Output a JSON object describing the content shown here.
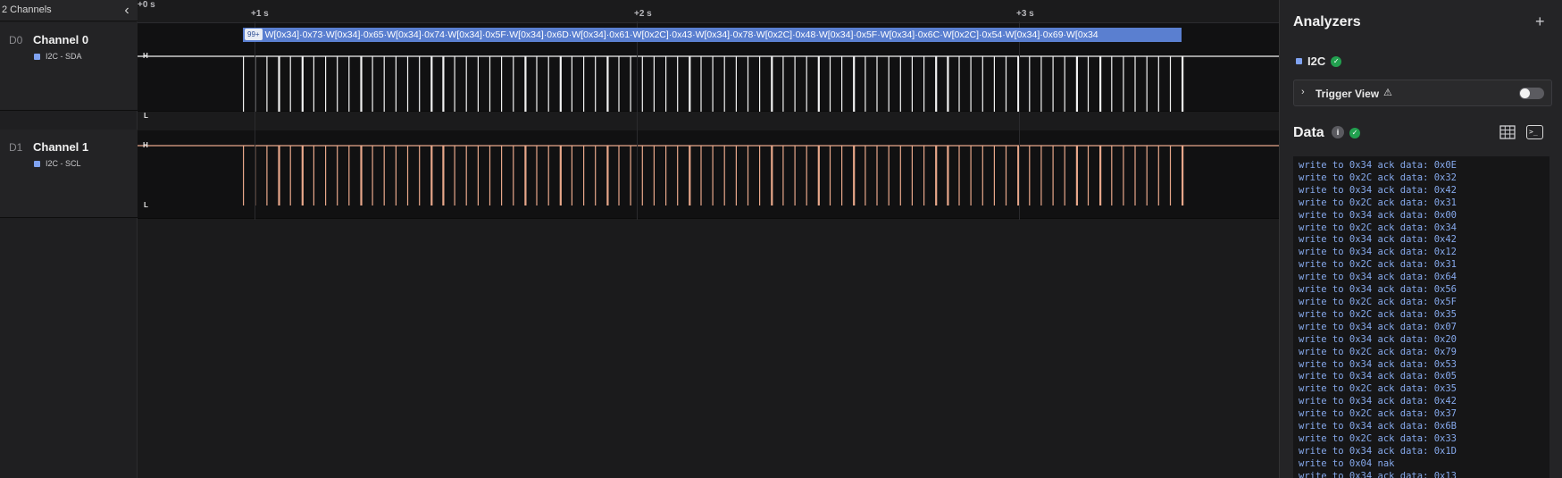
{
  "left_panel": {
    "title": "2 Channels",
    "collapse_icon": "chevron-left-icon",
    "channels": [
      {
        "id": "D0",
        "name": "Channel 0",
        "tag": "I2C - SDA",
        "tag_color": "#7fa2f0"
      },
      {
        "id": "D1",
        "name": "Channel 1",
        "tag": "I2C - SCL",
        "tag_color": "#7fa2f0"
      }
    ]
  },
  "timeline": {
    "start": "+0 s",
    "ticks": [
      "+1 s",
      "+2 s",
      "+3 s"
    ]
  },
  "lanes": {
    "high_label": "H",
    "low_label": "L",
    "sda_color": "#f2f2f2",
    "scl_color": "#e8a78a"
  },
  "decode": {
    "badge": "99+",
    "text": "W[0x34]·0x73·W[0x34]·0x65·W[0x34]·0x74·W[0x34]·0x5F·W[0x34]·0x6D·W[0x34]·0x61·W[0x2C]·0x43·W[0x34]·0x78·W[0x2C]·0x48·W[0x34]·0x5F·W[0x34]·0x6C·W[0x2C]·0x54·W[0x34]·0x69·W[0x34",
    "color": "#5a7fd0"
  },
  "analyzers": {
    "title": "Analyzers",
    "add_icon": "+",
    "analyzer_name": "I2C",
    "analyzer_color": "#7fa2f0",
    "status_icon": "✓",
    "trigger": {
      "chevron": "›",
      "label": "Trigger View",
      "warning": "⚠",
      "enabled": false
    },
    "data_title": "Data",
    "info_icon": "i",
    "terminal_lines": [
      "write to 0x34 ack data: 0x0E",
      "write to 0x2C ack data: 0x32",
      "write to 0x34 ack data: 0x42",
      "write to 0x2C ack data: 0x31",
      "write to 0x34 ack data: 0x00",
      "write to 0x2C ack data: 0x34",
      "write to 0x34 ack data: 0x42",
      "write to 0x34 ack data: 0x12",
      "write to 0x2C ack data: 0x31",
      "write to 0x34 ack data: 0x64",
      "write to 0x34 ack data: 0x56",
      "write to 0x2C ack data: 0x5F",
      "write to 0x2C ack data: 0x35",
      "write to 0x34 ack data: 0x07",
      "write to 0x34 ack data: 0x20",
      "write to 0x2C ack data: 0x79",
      "write to 0x34 ack data: 0x53",
      "write to 0x34 ack data: 0x05",
      "write to 0x2C ack data: 0x35",
      "write to 0x34 ack data: 0x42",
      "write to 0x2C ack data: 0x37",
      "write to 0x34 ack data: 0x6B",
      "write to 0x2C ack data: 0x33",
      "write to 0x34 ack data: 0x1D",
      "write to 0x04 nak",
      "write to 0x34 ack data: 0x13"
    ]
  }
}
